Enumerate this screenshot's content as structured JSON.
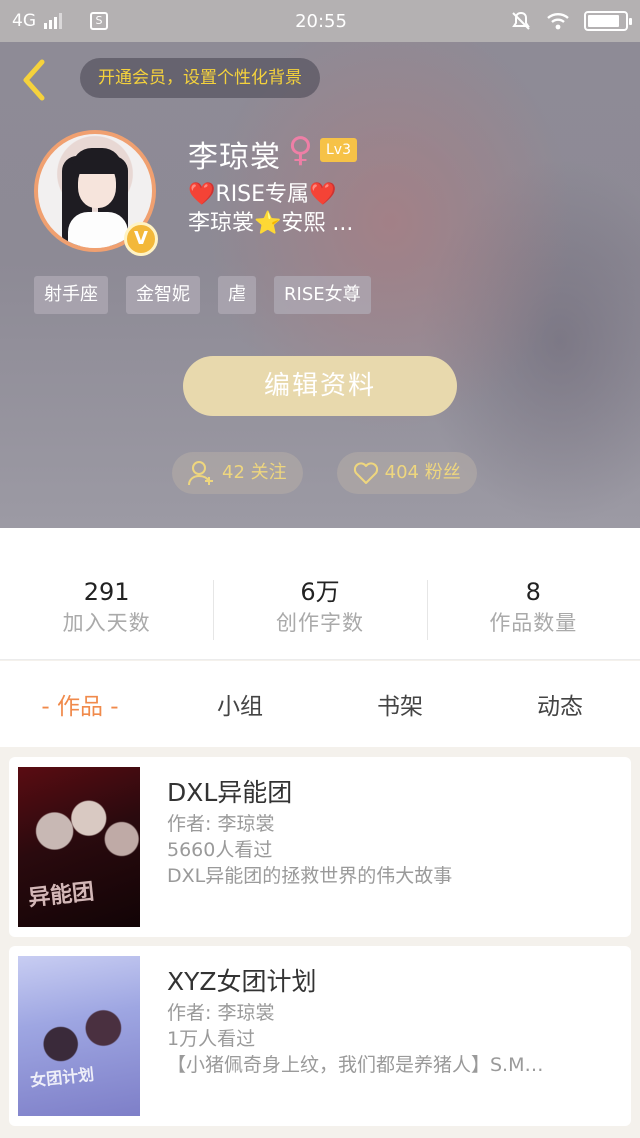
{
  "status_bar": {
    "network": "4G",
    "time": "20:55",
    "icons": [
      "signal-icon",
      "s-app-icon",
      "mute-icon",
      "wifi-icon",
      "battery-icon"
    ],
    "battery_level": 0.85
  },
  "header": {
    "vip_banner": "开通会员，设置个性化背景",
    "username": "李琼裳",
    "gender_symbol": "♀",
    "level": "Lv3",
    "verified_badge": "V",
    "bio": {
      "line1_heart_left": "❤️",
      "line1_text": "RISE专属",
      "line1_heart_right": "❤️",
      "line2_name": "李琼裳",
      "line2_star": "⭐",
      "line2_rest": "安熙 ..."
    },
    "tags": [
      "射手座",
      "金智妮",
      "虐",
      "RISE女尊"
    ],
    "edit_button": "编辑资料",
    "following": "42 关注",
    "followers": "404 粉丝"
  },
  "stats": [
    {
      "value": "291",
      "label": "加入天数"
    },
    {
      "value": "6万",
      "label": "创作字数"
    },
    {
      "value": "8",
      "label": "作品数量"
    }
  ],
  "tabs": [
    "- 作品 -",
    "小组",
    "书架",
    "动态"
  ],
  "works": [
    {
      "title": "DXL异能团",
      "author": "作者: 李琼裳",
      "views": "5660人看过",
      "description": "DXL异能团的拯救世界的伟大故事",
      "cover_text": "异能团"
    },
    {
      "title": "XYZ女团计划",
      "author": "作者: 李琼裳",
      "views": "1万人看过",
      "description": "【小猪佩奇身上纹，我们都是养猪人】S.M…",
      "cover_text": "女团计划"
    }
  ],
  "colors": {
    "accent": "#f08a4b",
    "vip_text": "#f5d23c",
    "edit_button_bg": "#e8d9ad",
    "level_badge": "#f6c247"
  }
}
